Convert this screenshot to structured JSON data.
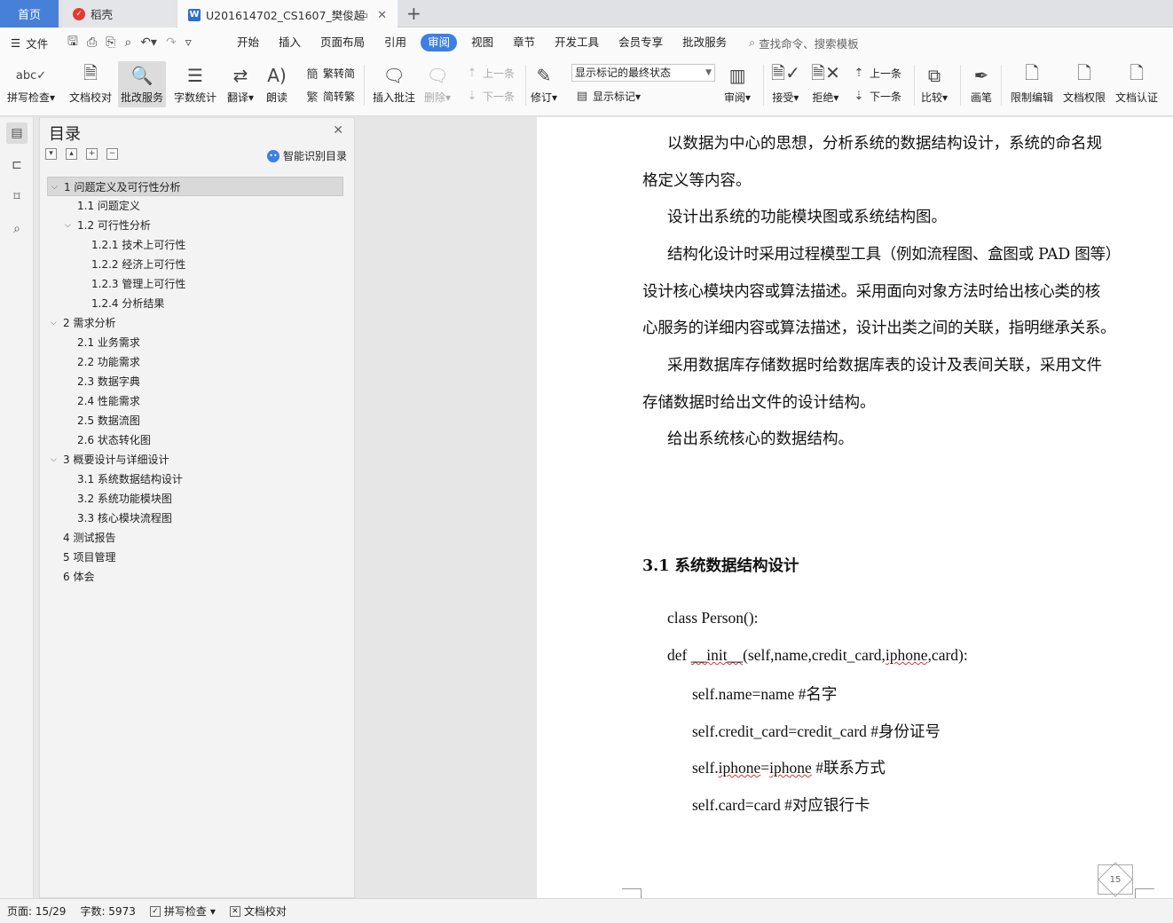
{
  "tabs": {
    "home": "首页",
    "daoke": "稻壳",
    "doc": "U201614702_CS1607_樊俊超"
  },
  "menu": {
    "file": "文件",
    "tabs": [
      "开始",
      "插入",
      "页面布局",
      "引用",
      "审阅",
      "视图",
      "章节",
      "开发工具",
      "会员专享",
      "批改服务"
    ],
    "active_tab": "审阅",
    "search_placeholder": "查找命令、搜索模板"
  },
  "ribbon": {
    "spell_check": "拼写检查",
    "doc_proof": "文档校对",
    "correction_service": "批改服务",
    "word_count": "字数统计",
    "translate": "翻译",
    "read_aloud": "朗读",
    "trad_to_simp": "繁转简",
    "simp_to_trad": "简转繁",
    "insert_comment": "插入批注",
    "delete": "删除",
    "prev": "上一条",
    "next": "下一条",
    "track_changes": "修订",
    "markup_state": "显示标记的最终状态",
    "show_markup": "显示标记",
    "review": "审阅",
    "accept": "接受",
    "reject": "拒绝",
    "prev2": "上一条",
    "next2": "下一条",
    "compare": "比较",
    "pen": "画笔",
    "restrict_edit": "限制编辑",
    "doc_permission": "文档权限",
    "doc_auth": "文档认证"
  },
  "toc": {
    "title": "目录",
    "smart": "智能识别目录",
    "items": [
      {
        "text": "1 问题定义及可行性分析",
        "level": 1,
        "arrow": true,
        "selected": true
      },
      {
        "text": "1.1 问题定义",
        "level": 2,
        "arrow": false
      },
      {
        "text": "1.2 可行性分析",
        "level": 2,
        "arrow": true
      },
      {
        "text": "1.2.1 技术上可行性",
        "level": 3,
        "arrow": false
      },
      {
        "text": "1.2.2 经济上可行性",
        "level": 3,
        "arrow": false
      },
      {
        "text": "1.2.3 管理上可行性",
        "level": 3,
        "arrow": false
      },
      {
        "text": "1.2.4 分析结果",
        "level": 3,
        "arrow": false
      },
      {
        "text": "2 需求分析",
        "level": 1,
        "arrow": true
      },
      {
        "text": "2.1 业务需求",
        "level": 2,
        "arrow": false
      },
      {
        "text": "2.2 功能需求",
        "level": 2,
        "arrow": false
      },
      {
        "text": "2.3 数据字典",
        "level": 2,
        "arrow": false
      },
      {
        "text": "2.4 性能需求",
        "level": 2,
        "arrow": false
      },
      {
        "text": "2.5 数据流图",
        "level": 2,
        "arrow": false
      },
      {
        "text": "2.6 状态转化图",
        "level": 2,
        "arrow": false
      },
      {
        "text": "3 概要设计与详细设计",
        "level": 1,
        "arrow": true
      },
      {
        "text": "3.1 系统数据结构设计",
        "level": 2,
        "arrow": false
      },
      {
        "text": "3.2 系统功能模块图",
        "level": 2,
        "arrow": false
      },
      {
        "text": "3.3 核心模块流程图",
        "level": 2,
        "arrow": false
      },
      {
        "text": "4 测试报告",
        "level": 1,
        "arrow": false
      },
      {
        "text": "5 项目管理",
        "level": 1,
        "arrow": false
      },
      {
        "text": "6 体会",
        "level": 1,
        "arrow": false
      }
    ]
  },
  "document": {
    "p1_line1": "以数据为中心的思想，分析系统的数据结构设计，系统的命名规",
    "p1_line2": "格定义等内容。",
    "p2": "设计出系统的功能模块图或系统结构图。",
    "p3_line1": "结构化设计时采用过程模型工具（例如流程图、盒图或 PAD 图等）",
    "p3_line2": "设计核心模块内容或算法描述。采用面向对象方法时给出核心类的核",
    "p3_line3": "心服务的详细内容或算法描述，设计出类之间的关联，指明继承关系。",
    "p4_line1": "采用数据库存储数据时给数据库表的设计及表间关联，采用文件",
    "p4_line2": "存储数据时给出文件的设计结构。",
    "p5": "给出系统核心的数据结构。",
    "heading": "3.1 系统数据结构设计",
    "code1": "class Person():",
    "code2a": "def ",
    "code2b": "__init__",
    "code2c": "(self,name,credit_card,",
    "code2d": "iphone",
    "code2e": ",card):",
    "code3": "self.name=name #名字",
    "code4": "self.credit_card=credit_card #身份证号",
    "code5a": "self.",
    "code5b": "iphone",
    "code5c": "=",
    "code5d": "iphone",
    "code5e": " #联系方式",
    "code6": "self.card=card #对应银行卡",
    "page_badge": "15"
  },
  "status": {
    "page": "页面: 15/29",
    "words": "字数: 5973",
    "spell": "拼写检查",
    "proof": "文档校对"
  }
}
